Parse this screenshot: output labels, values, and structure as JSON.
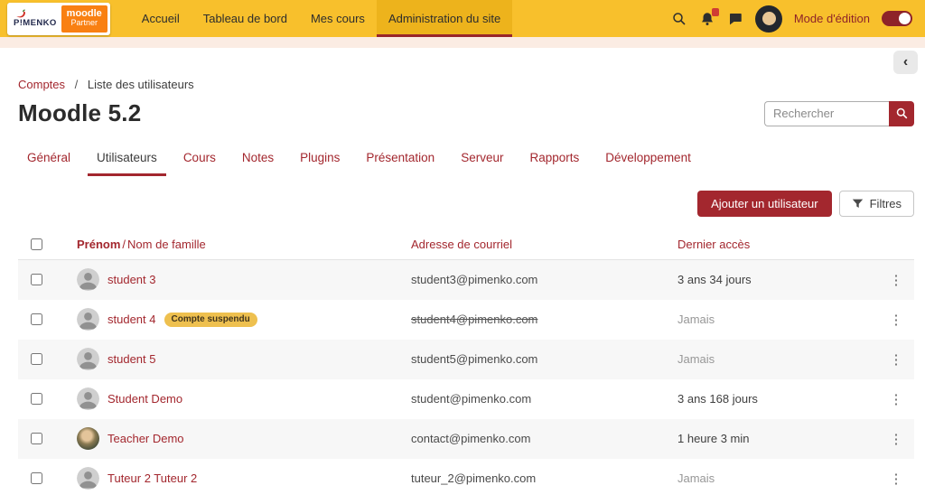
{
  "colors": {
    "navbar-bg": "#F8C02C",
    "navbar-active-bg": "#EDB31C",
    "accent": "#A3272E",
    "accent-dark": "#8E2329",
    "pink-strip": "#FBECE3",
    "stripe": "#F7F7F7",
    "badge-bg": "#EEC04F",
    "moodle-orange": "#F98012"
  },
  "navbar": {
    "logo": {
      "brand": "P!MENKO",
      "partner_top": "moodle",
      "partner_bottom": "Partner"
    },
    "items": [
      {
        "label": "Accueil",
        "active": false
      },
      {
        "label": "Tableau de bord",
        "active": false
      },
      {
        "label": "Mes cours",
        "active": false
      },
      {
        "label": "Administration du site",
        "active": true
      }
    ],
    "edit_mode_label": "Mode d'édition",
    "edit_mode_on": true
  },
  "breadcrumb": {
    "link": "Comptes",
    "separator": "/",
    "current": "Liste des utilisateurs"
  },
  "page": {
    "title": "Moodle 5.2"
  },
  "search": {
    "placeholder": "Rechercher"
  },
  "tabs": [
    {
      "label": "Général",
      "active": false
    },
    {
      "label": "Utilisateurs",
      "active": true
    },
    {
      "label": "Cours",
      "active": false
    },
    {
      "label": "Notes",
      "active": false
    },
    {
      "label": "Plugins",
      "active": false
    },
    {
      "label": "Présentation",
      "active": false
    },
    {
      "label": "Serveur",
      "active": false
    },
    {
      "label": "Rapports",
      "active": false
    },
    {
      "label": "Développement",
      "active": false
    }
  ],
  "actions": {
    "add_user": "Ajouter un utilisateur",
    "filters": "Filtres"
  },
  "table": {
    "headers": {
      "name_first": "Prénom",
      "name_separator": "/",
      "name_last": "Nom de famille",
      "email": "Adresse de courriel",
      "last_access": "Dernier accès"
    },
    "rows": [
      {
        "name": "student 3",
        "email": "student3@pimenko.com",
        "last_access": "3 ans 34 jours",
        "suspended": false,
        "avatar": "default"
      },
      {
        "name": "student 4",
        "badge": "Compte suspendu",
        "email": "student4@pimenko.com",
        "last_access": "Jamais",
        "suspended": true,
        "avatar": "default"
      },
      {
        "name": "student 5",
        "email": "student5@pimenko.com",
        "last_access": "Jamais",
        "suspended": false,
        "avatar": "default"
      },
      {
        "name": "Student Demo",
        "email": "student@pimenko.com",
        "last_access": "3 ans 168 jours",
        "suspended": false,
        "avatar": "default"
      },
      {
        "name": "Teacher Demo",
        "email": "contact@pimenko.com",
        "last_access": "1 heure 3 min",
        "suspended": false,
        "avatar": "photo"
      },
      {
        "name": "Tuteur 2 Tuteur 2",
        "email": "tuteur_2@pimenko.com",
        "last_access": "Jamais",
        "suspended": false,
        "avatar": "default"
      }
    ]
  }
}
